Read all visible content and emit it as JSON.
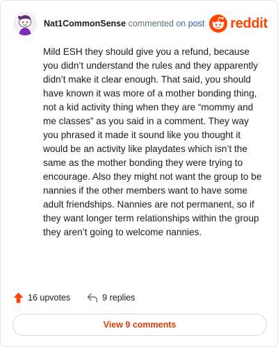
{
  "header": {
    "username": "Nat1CommonSense",
    "action": "commented on",
    "post_link": "post",
    "brand": "reddit",
    "avatar_icon": "snoo-avatar-icon",
    "brand_icon": "reddit-alien-icon"
  },
  "comment": {
    "text": "Mild ESH they should give you a refund, because you didn’t understand the rules and they apparently didn’t make it clear enough. That said, you should have known it was more of a mother bonding thing, not a kid activity thing when they are “mommy and me classes” as you said in a comment. They way you phrased it made it sound like you thought it would be an activity like playdates which isn’t the same as the mother bonding they were trying to encourage. Also they might not want the group to be nannies if the other members want to have some adult friendships. Nannies are not permanent, so if they want longer term relationships within the group they aren’t going to welcome nannies."
  },
  "stats": {
    "upvotes": "16 upvotes",
    "replies": "9 replies",
    "upvote_icon": "upvote-arrow-icon",
    "reply_icon": "reply-arrow-icon"
  },
  "footer": {
    "view_comments": "View 9 comments"
  },
  "colors": {
    "brand": "#ff4500",
    "link": "#2a5db0",
    "muted": "#576f76",
    "button_text": "#d93a00"
  }
}
